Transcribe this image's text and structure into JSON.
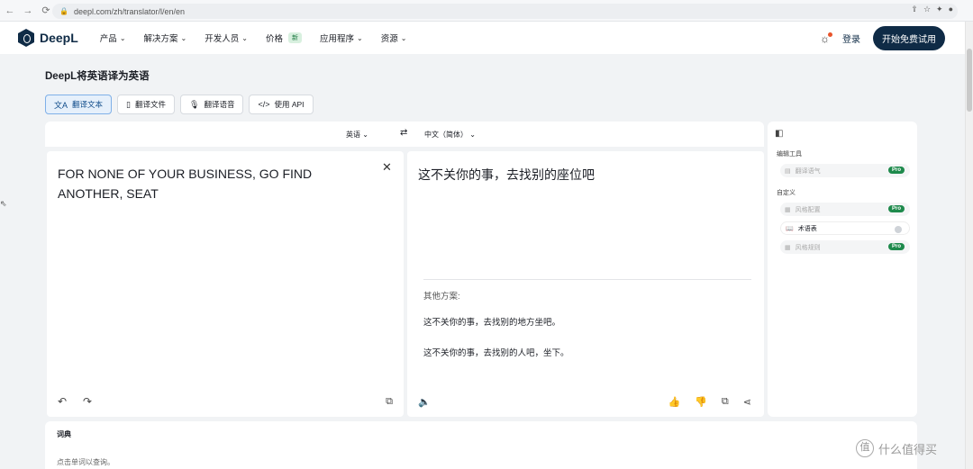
{
  "browser": {
    "url": "deepl.com/zh/translator/l/en/en"
  },
  "nav": {
    "logo_text": "DeepL",
    "items": [
      {
        "label": "产品",
        "chevron": true
      },
      {
        "label": "解决方案",
        "chevron": true
      },
      {
        "label": "开发人员",
        "chevron": true
      },
      {
        "label": "价格",
        "badge": "新",
        "chevron": false
      },
      {
        "label": "应用程序",
        "chevron": true
      },
      {
        "label": "资源",
        "chevron": true
      }
    ],
    "login_label": "登录",
    "trial_label": "开始免费试用"
  },
  "page_title": "DeepL将英语译为英语",
  "tabs": [
    {
      "label": "翻译文本",
      "icon": "translate-icon",
      "active": true
    },
    {
      "label": "翻译文件",
      "icon": "file-icon",
      "active": false
    },
    {
      "label": "翻译语音",
      "icon": "mic-icon",
      "active": false
    },
    {
      "label": "使用 API",
      "icon": "code-icon",
      "active": false
    }
  ],
  "languages": {
    "source": "英语",
    "target": "中文（简体）"
  },
  "source": {
    "text": "FOR NONE OF YOUR BUSINESS, GO FIND ANOTHER, SEAT"
  },
  "target": {
    "text": "这不关你的事，去找别的座位吧",
    "alternatives_label": "其他方案:",
    "alternatives": [
      "这不关你的事，去找别的地方坐吧。",
      "这不关你的事，去找别的人吧，坐下。"
    ]
  },
  "sidebar": {
    "editing_tools_label": "编辑工具",
    "tone_label": "翻译语气",
    "customize_label": "自定义",
    "style_match_label": "风格配置",
    "glossary_label": "术语表",
    "style_rules_label": "风格规则",
    "pro_badge": "Pro"
  },
  "dictionary": {
    "title": "词典",
    "hint": "点击单词以查询。"
  },
  "watermark": {
    "logo_char": "值",
    "text": "什么值得买"
  },
  "colors": {
    "brand": "#0f2b46",
    "pro": "#1e8a4c",
    "active_tab": "#e6f0fb"
  }
}
